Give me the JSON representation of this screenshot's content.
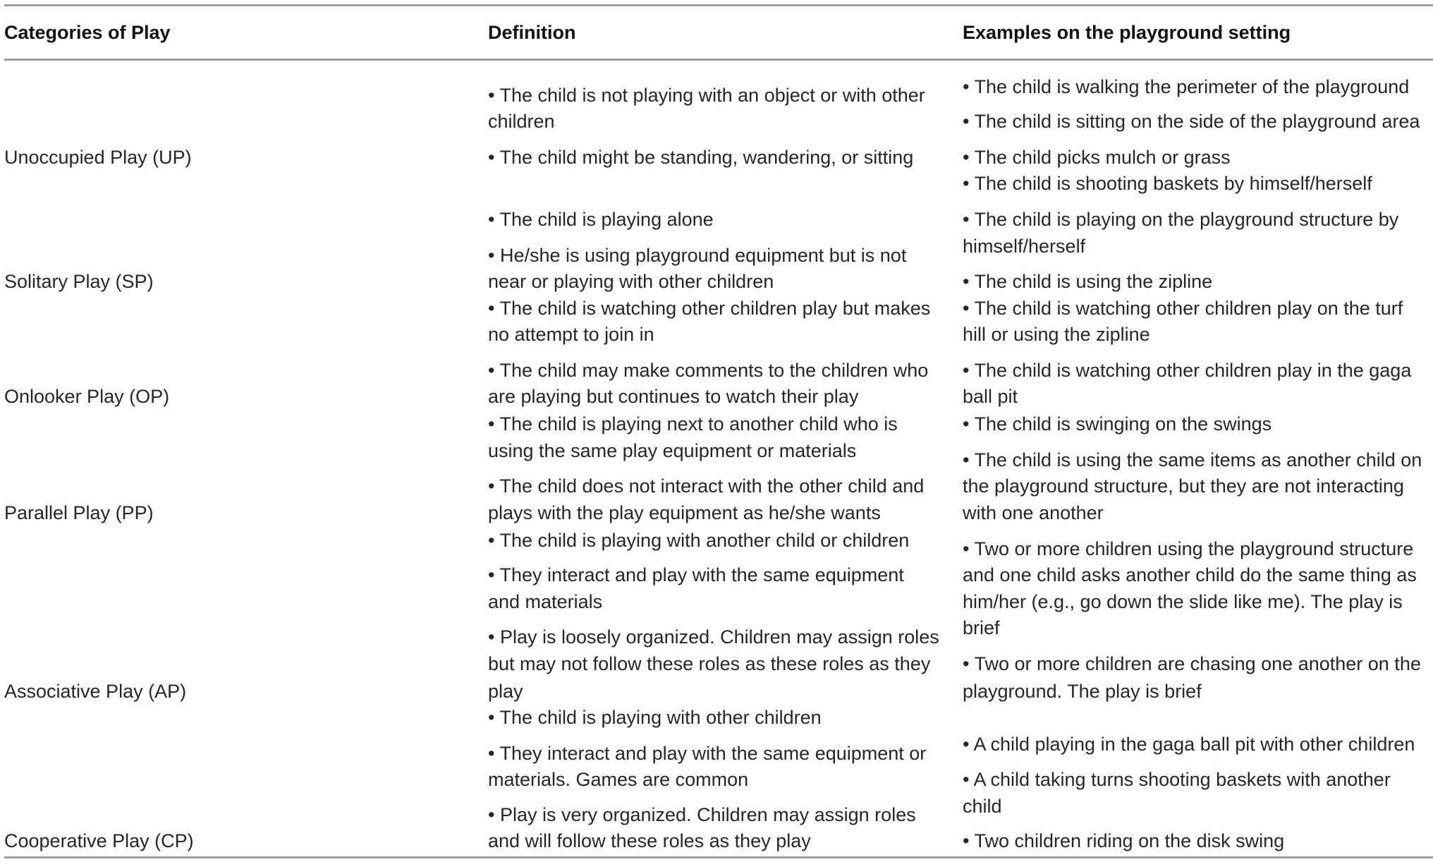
{
  "table": {
    "headers": [
      "Categories of Play",
      "Definition",
      "Examples on the playground setting"
    ],
    "rows": [
      {
        "category": "Unoccupied Play (UP)",
        "definition": [
          "• The child is not playing with an object or with other",
          "children",
          "• The child might be standing, wandering, or sitting"
        ],
        "examples": [
          "• The child is walking the perimeter of the playground",
          "• The child is sitting on the side of the playground area",
          "• The child picks mulch or grass",
          "• The child is shooting baskets by himself/herself"
        ]
      },
      {
        "category": "Solitary Play (SP)",
        "definition": [
          "• The child is playing alone",
          "• He/she is using playground equipment but is not",
          "near or playing with other children"
        ],
        "examples": [
          "• The child is playing on the playground structure by",
          "himself/herself",
          "• The child is using the zipline"
        ]
      },
      {
        "category": "Onlooker Play (OP)",
        "definition": [
          "• The child is watching other children play but makes",
          "no attempt to join in",
          "• The child may make comments to the children who",
          "are playing but continues to watch their play"
        ],
        "examples": [
          "• The child is watching other children play on the turf",
          "hill or using the zipline",
          "• The child is watching other children play in the gaga",
          "ball pit"
        ]
      },
      {
        "category": "Parallel Play (PP)",
        "definition": [
          "• The child is playing next to another child who is",
          "using the same play equipment or materials",
          "• The child does not interact with the other child and",
          "plays with the play equipment as he/she wants"
        ],
        "examples": [
          "• The child is swinging on the swings",
          "• The child is using the same items as another child on",
          "the playground structure, but they are not interacting",
          "with one another"
        ]
      },
      {
        "category": "Associative Play (AP)",
        "definition": [
          "• The child is playing with another child or children",
          "• They interact and play with the same equipment",
          "and materials",
          "• Play is loosely organized. Children may assign roles",
          "but may not follow these roles as these roles as they",
          "play"
        ],
        "examples": [
          "• Two or more children using the playground structure",
          "and one child asks another child do the same thing as",
          "him/her (e.g., go down the slide like me). The play is",
          "brief",
          "• Two or more children are chasing one another on the",
          "playground. The play is brief"
        ]
      },
      {
        "category": "Cooperative Play (CP)",
        "definition": [
          "• The child is playing with other children",
          "• They interact and play with the same equipment or",
          "materials. Games are common",
          "• Play is very organized. Children may assign roles",
          "and will follow these roles as they play"
        ],
        "examples": [
          "• A child playing in the gaga ball pit with other children",
          "• A child taking turns shooting baskets with another",
          "child",
          "• Two children riding on the disk swing"
        ]
      }
    ]
  }
}
